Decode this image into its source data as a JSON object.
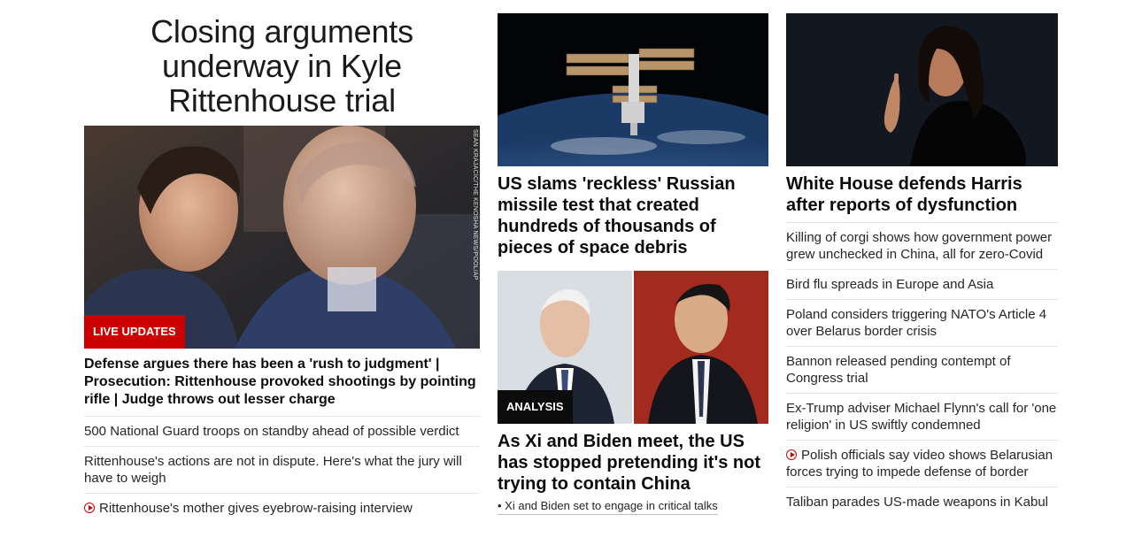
{
  "col1": {
    "headline": "Closing arguments underway in Kyle Rittenhouse trial",
    "hero_badge": "LIVE UPDATES",
    "hero_credit": "SEAN KRAJACIC/THE KENOSHA NEWS/POOL/AP",
    "lead_link": "Defense argues there has been a 'rush to judgment' | Prosecution: Rittenhouse provoked shootings by pointing rifle | Judge throws out lesser charge",
    "links": [
      {
        "text": "500 National Guard troops on standby ahead of possible verdict",
        "icon": ""
      },
      {
        "text": "Rittenhouse's actions are not in dispute. Here's what the jury will have to weigh",
        "icon": ""
      },
      {
        "text": "Rittenhouse's mother gives eyebrow-raising interview",
        "icon": "play-icon"
      }
    ]
  },
  "col2": {
    "story1_headline": "US slams 'reckless' Russian missile test that created hundreds of thousands of pieces of space debris",
    "story2_badge": "ANALYSIS",
    "story2_headline": "As Xi and Biden meet, the US has stopped pretending it's not trying to contain China",
    "story2_bullet": "• Xi and Biden set to engage in critical talks"
  },
  "col3": {
    "headline": "White House defends Harris after reports of dysfunction",
    "links": [
      {
        "text": "Killing of corgi shows how government power grew unchecked in China, all for zero-Covid",
        "icon": ""
      },
      {
        "text": "Bird flu spreads in Europe and Asia",
        "icon": ""
      },
      {
        "text": "Poland considers triggering NATO's Article 4 over Belarus border crisis",
        "icon": ""
      },
      {
        "text": "Bannon released pending contempt of Congress trial",
        "icon": ""
      },
      {
        "text": "Ex-Trump adviser Michael Flynn's call for 'one religion' in US swiftly condemned",
        "icon": ""
      },
      {
        "text": "Polish officials say video shows Belarusian forces trying to impede defense of border",
        "icon": "play-icon"
      },
      {
        "text": "Taliban parades US-made weapons in Kabul",
        "icon": ""
      }
    ]
  },
  "colors": {
    "live_badge": "#cc0000",
    "analysis_badge": "#0c0c0c",
    "divider": "#e6e6e6",
    "text": "#0c0c0c"
  }
}
